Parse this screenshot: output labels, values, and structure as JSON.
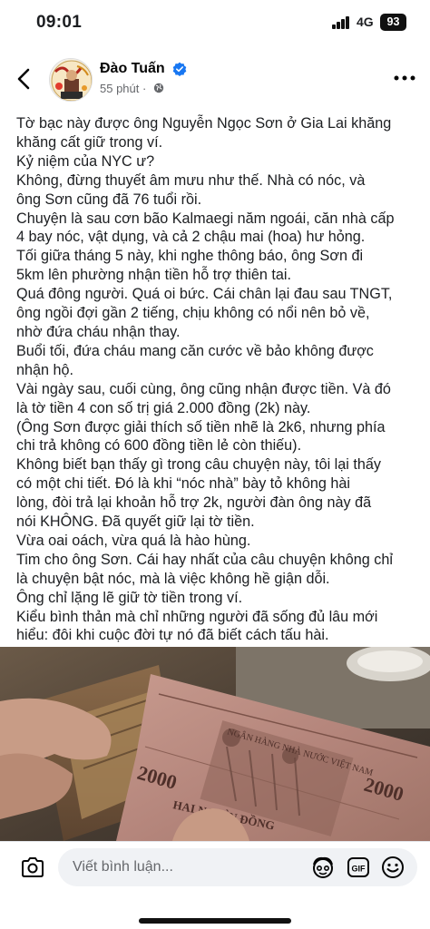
{
  "status_bar": {
    "time": "09:01",
    "network": "4G",
    "battery": "93"
  },
  "post": {
    "author": "Đào Tuấn",
    "time": "55 phút",
    "separator": "·",
    "lines": [
      "Tờ bạc này được ông Nguyễn Ngọc Sơn ở Gia Lai khăng",
      "khăng cất giữ trong ví.",
      "Kỷ niệm của NYC ư?",
      "Không, đừng thuyết âm mưu như thế. Nhà có nóc, và",
      "ông Sơn cũng đã 76 tuổi rồi.",
      "Chuyện là sau cơn bão Kalmaegi năm ngoái, căn nhà cấp",
      "4 bay nóc, vật dụng, và cả 2 chậu mai (hoa) hư hỏng.",
      "Tối giữa tháng 5 này, khi nghe thông báo,  ông Sơn đi",
      "5km lên phường nhận tiền hỗ trợ thiên tai.",
      "Quá đông người. Quá oi bức. Cái chân lại đau sau TNGT,",
      "ông ngồi đợi gần 2 tiếng, chịu không có nổi nên bỏ về,",
      "nhờ đứa cháu nhận thay.",
      "Buổi tối, đứa cháu mang căn cước về bảo không được",
      "nhận hộ.",
      "Vài ngày sau, cuối cùng, ông cũng nhận được tiền. Và đó",
      "là tờ tiền 4 con số trị giá 2.000 đồng (2k) này.",
      "(Ông Sơn được giải thích số tiền nhẽ là 2k6, nhưng phía",
      "chi trả không có 600 đồng tiền lẻ còn thiếu).",
      "Không biết bạn thấy gì trong câu chuyện này, tôi lại thấy",
      "có một chi tiết. Đó là khi “nóc nhà” bày tỏ không hài",
      "lòng, đòi trả lại khoản hỗ trợ 2k, người đàn ông này đã",
      "nói KHÔNG. Đã quyết giữ lại tờ tiền.",
      "Vừa oai oách, vừa quá là hào hùng.",
      "Tim cho ông Sơn. Cái hay nhất của câu chuyện không chỉ",
      "là chuyện bật nóc, mà là việc không hề giận dỗi.",
      "Ông chỉ lặng lẽ giữ tờ tiền trong ví.",
      "Kiểu bình thản mà chỉ những người đã sống đủ lâu mới",
      "hiểu: đôi khi cuộc đời tự nó đã biết cách tấu hài."
    ],
    "photo": {
      "banknote_header": "NGÂN HÀNG NHÀ NƯỚC VIỆT NAM",
      "denomination": "2000",
      "denomination_words": "HAI NGHÌN ĐỒNG"
    }
  },
  "comment_bar": {
    "placeholder": "Viết bình luận..."
  },
  "icons": [
    "back-icon",
    "verified-icon",
    "globe-icon",
    "more-icon",
    "camera-icon",
    "avatar-sticker-icon",
    "gif-icon",
    "emoji-icon"
  ],
  "colors": {
    "text": "#1c1e21",
    "secondary": "#65676b",
    "verified": "#1877f2",
    "input_bg": "#f0f2f5",
    "banknote": "#b98a80"
  }
}
